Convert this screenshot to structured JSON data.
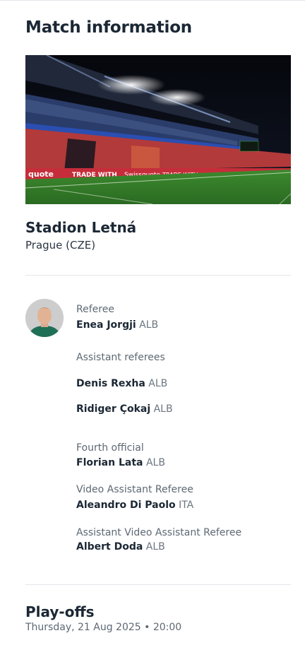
{
  "section": {
    "title": "Match information"
  },
  "stadium": {
    "name": "Stadion Letná",
    "city": "Prague (CZE)",
    "photo_icon": "stadium-photo",
    "boards": [
      "quote",
      "TRADE WITH",
      "Swissquote",
      "TRADE WITH"
    ]
  },
  "officials": {
    "referee": {
      "label": "Referee",
      "name": "Enea Jorgji",
      "nationality": "ALB"
    },
    "assistants": {
      "label": "Assistant referees",
      "people": [
        {
          "name": "Denis Rexha",
          "nationality": "ALB"
        },
        {
          "name": "Ridiger Çokaj",
          "nationality": "ALB"
        }
      ]
    },
    "fourth": {
      "label": "Fourth official",
      "name": "Florian Lata",
      "nationality": "ALB"
    },
    "var": {
      "label": "Video Assistant Referee",
      "name": "Aleandro Di Paolo",
      "nationality": "ITA"
    },
    "avar": {
      "label": "Assistant Video Assistant Referee",
      "name": "Albert Doda",
      "nationality": "ALB"
    }
  },
  "match": {
    "stage": "Play-offs",
    "date": "Thursday, 21 Aug 2025 • 20:00"
  },
  "colors": {
    "text": "#1b2734",
    "muted": "#5d6873",
    "divider": "#e3e6ea",
    "pitch": "#2f7a2a"
  }
}
